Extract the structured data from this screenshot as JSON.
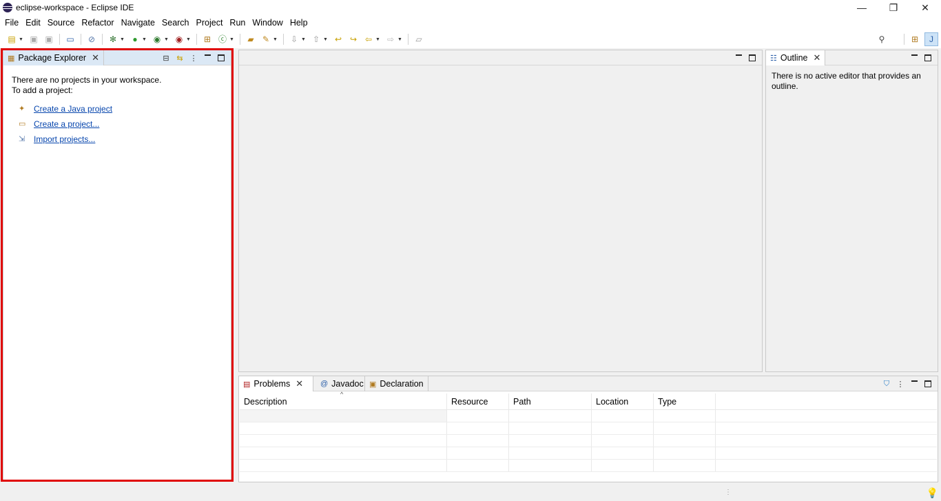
{
  "window": {
    "title": "eclipse-workspace - Eclipse IDE",
    "controls": {
      "minimize": "—",
      "restore": "❐",
      "close": "✕"
    }
  },
  "menu": [
    "File",
    "Edit",
    "Source",
    "Refactor",
    "Navigate",
    "Search",
    "Project",
    "Run",
    "Window",
    "Help"
  ],
  "package_explorer": {
    "tab_label": "Package Explorer",
    "message_line1": "There are no projects in your workspace.",
    "message_line2": "To add a project:",
    "links": [
      {
        "label": "Create a Java project",
        "icon": "java-project-icon"
      },
      {
        "label": "Create a project...",
        "icon": "new-project-icon"
      },
      {
        "label": "Import projects...",
        "icon": "import-icon"
      }
    ]
  },
  "outline": {
    "tab_label": "Outline",
    "message": "There is no active editor that provides an outline."
  },
  "bottom_panel": {
    "tabs": [
      "Problems",
      "Javadoc",
      "Declaration"
    ],
    "columns": [
      "Description",
      "Resource",
      "Path",
      "Location",
      "Type"
    ],
    "row_count": 5
  },
  "colors": {
    "highlight_border": "#e00000",
    "link": "#0645ad"
  }
}
